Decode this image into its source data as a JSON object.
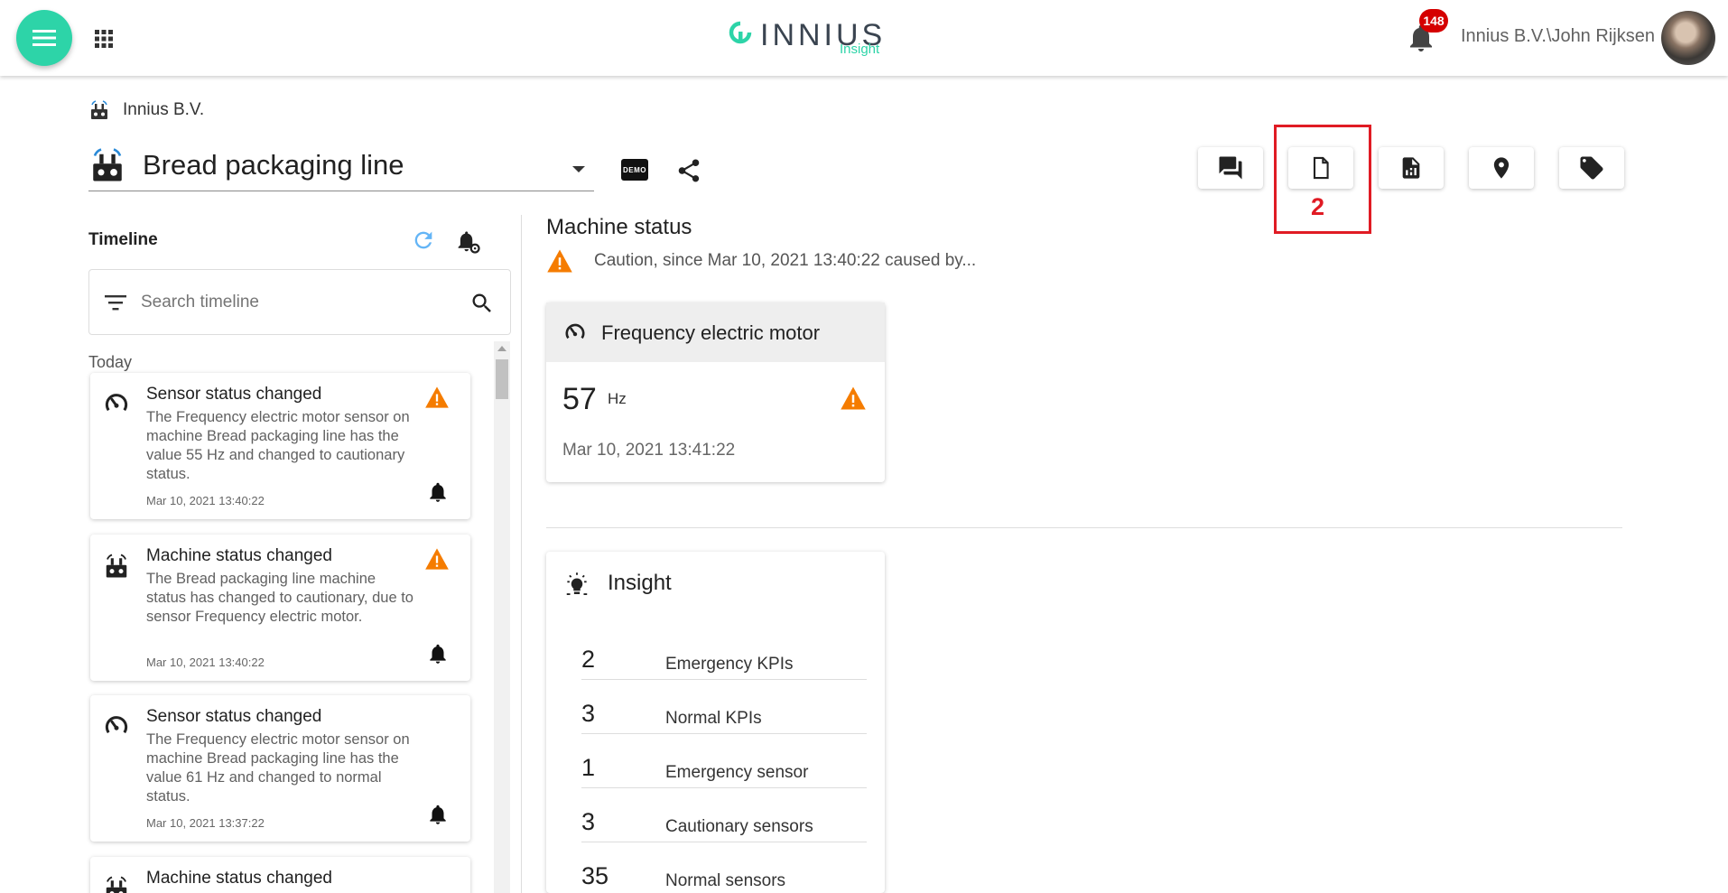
{
  "header": {
    "logo_text": "INNIUS",
    "logo_sub": "Insight",
    "notification_count": "148",
    "user": "Innius B.V.\\John Rijksen"
  },
  "breadcrumb": {
    "company": "Innius B.V."
  },
  "machine": {
    "name": "Bread packaging line",
    "demo_label": "DEMO"
  },
  "toolbar": {
    "buttons": [
      "chat-icon",
      "document-icon",
      "report-icon",
      "location-icon",
      "tag-icon"
    ],
    "highlight_label": "2"
  },
  "timeline": {
    "title": "Timeline",
    "search_placeholder": "Search timeline",
    "day_label": "Today",
    "items": [
      {
        "icon": "gauge-icon",
        "title": "Sensor status changed",
        "desc": "The Frequency electric motor sensor on machine Bread packaging line has the value 55 Hz and changed to cautionary status.",
        "time": "Mar 10, 2021 13:40:22",
        "warning": true
      },
      {
        "icon": "machine-icon",
        "title": "Machine status changed",
        "desc": "The Bread packaging line machine status has changed to cautionary, due to sensor Frequency electric motor.",
        "time": "Mar 10, 2021 13:40:22",
        "warning": true
      },
      {
        "icon": "gauge-icon",
        "title": "Sensor status changed",
        "desc": "The Frequency electric motor sensor on machine Bread packaging line has the value 61 Hz and changed to normal status.",
        "time": "Mar 10, 2021 13:37:22",
        "warning": false
      },
      {
        "icon": "machine-icon",
        "title": "Machine status changed",
        "desc": "",
        "time": "",
        "warning": false
      }
    ]
  },
  "machine_status": {
    "title": "Machine status",
    "summary": "Caution, since Mar 10, 2021 13:40:22 caused by..."
  },
  "sensor_card": {
    "title": "Frequency electric motor",
    "value": "57",
    "unit": "Hz",
    "timestamp": "Mar 10, 2021 13:41:22"
  },
  "insight": {
    "title": "Insight",
    "rows": [
      {
        "count": "2",
        "label": "Emergency KPIs"
      },
      {
        "count": "3",
        "label": "Normal KPIs"
      },
      {
        "count": "1",
        "label": "Emergency sensor"
      },
      {
        "count": "3",
        "label": "Cautionary sensors"
      },
      {
        "count": "35",
        "label": "Normal sensors"
      }
    ]
  },
  "colors": {
    "accent": "#2dd4a8",
    "warning": "#f57c00",
    "highlight": "#e01b24",
    "badge": "#d50000"
  }
}
